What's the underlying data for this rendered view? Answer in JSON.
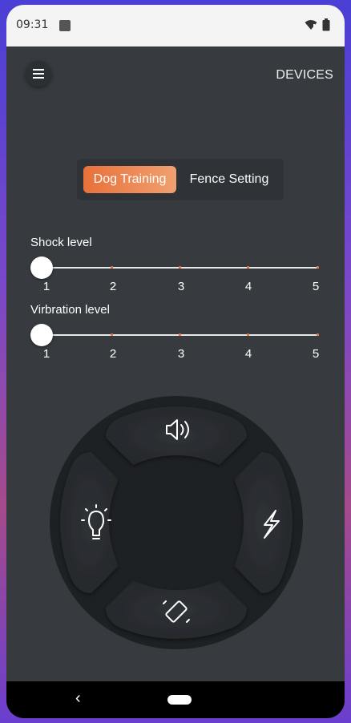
{
  "status_bar": {
    "time": "09:31"
  },
  "header": {
    "devices_label": "DEVICES"
  },
  "mode_toggle": {
    "active_label": "Dog Training",
    "inactive_label": "Fence Setting"
  },
  "sliders": [
    {
      "label": "Shock level",
      "value": 1,
      "ticks": [
        "1",
        "2",
        "3",
        "4",
        "5"
      ]
    },
    {
      "label": "Virbration level",
      "value": 1,
      "ticks": [
        "1",
        "2",
        "3",
        "4",
        "5"
      ]
    }
  ],
  "remote": {
    "top_icon": "speaker-icon",
    "left_icon": "light-bulb-icon",
    "right_icon": "lightning-icon",
    "bottom_icon": "vibration-icon"
  },
  "colors": {
    "accent_start": "#e8713a",
    "accent_end": "#f0a070",
    "background": "#373b3f"
  }
}
